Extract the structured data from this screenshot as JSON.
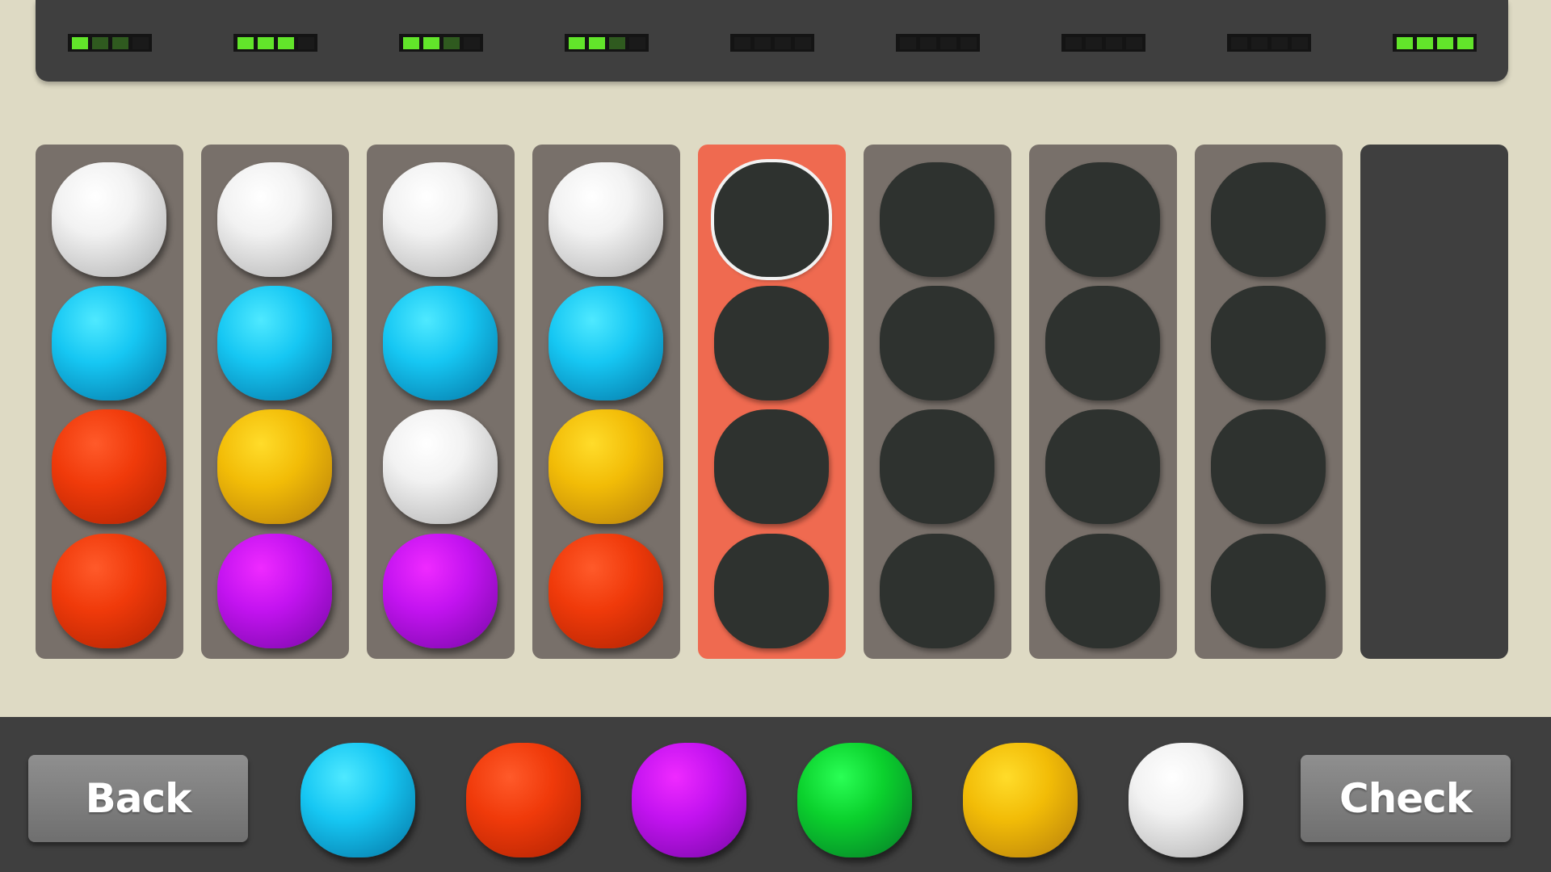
{
  "feedback": [
    [
      "green",
      "dark",
      "dark",
      "black"
    ],
    [
      "green",
      "green",
      "green",
      "black"
    ],
    [
      "green",
      "green",
      "dark",
      "black"
    ],
    [
      "green",
      "green",
      "dark",
      "black"
    ],
    [
      "black",
      "black",
      "black",
      "black"
    ],
    [
      "black",
      "black",
      "black",
      "black"
    ],
    [
      "black",
      "black",
      "black",
      "black"
    ],
    [
      "black",
      "black",
      "black",
      "black"
    ],
    [
      "green",
      "green",
      "green",
      "green"
    ]
  ],
  "guesses": [
    [
      "white",
      "cyan",
      "red",
      "red"
    ],
    [
      "white",
      "cyan",
      "yellow",
      "purple"
    ],
    [
      "white",
      "cyan",
      "white",
      "purple"
    ],
    [
      "white",
      "cyan",
      "yellow",
      "red"
    ],
    [
      "empty",
      "empty",
      "empty",
      "empty"
    ],
    [
      "empty",
      "empty",
      "empty",
      "empty"
    ],
    [
      "empty",
      "empty",
      "empty",
      "empty"
    ],
    [
      "empty",
      "empty",
      "empty",
      "empty"
    ]
  ],
  "active_column": 4,
  "selected_slot": 0,
  "palette": [
    "cyan",
    "red",
    "purple",
    "green",
    "yellow",
    "white"
  ],
  "buttons": {
    "back": "Back",
    "check": "Check"
  },
  "colors": {
    "background": "#dedac4",
    "panel": "#3f3f3f",
    "column": "#78706a",
    "active_column": "#ef6a50",
    "led_on": "#62e52a"
  }
}
